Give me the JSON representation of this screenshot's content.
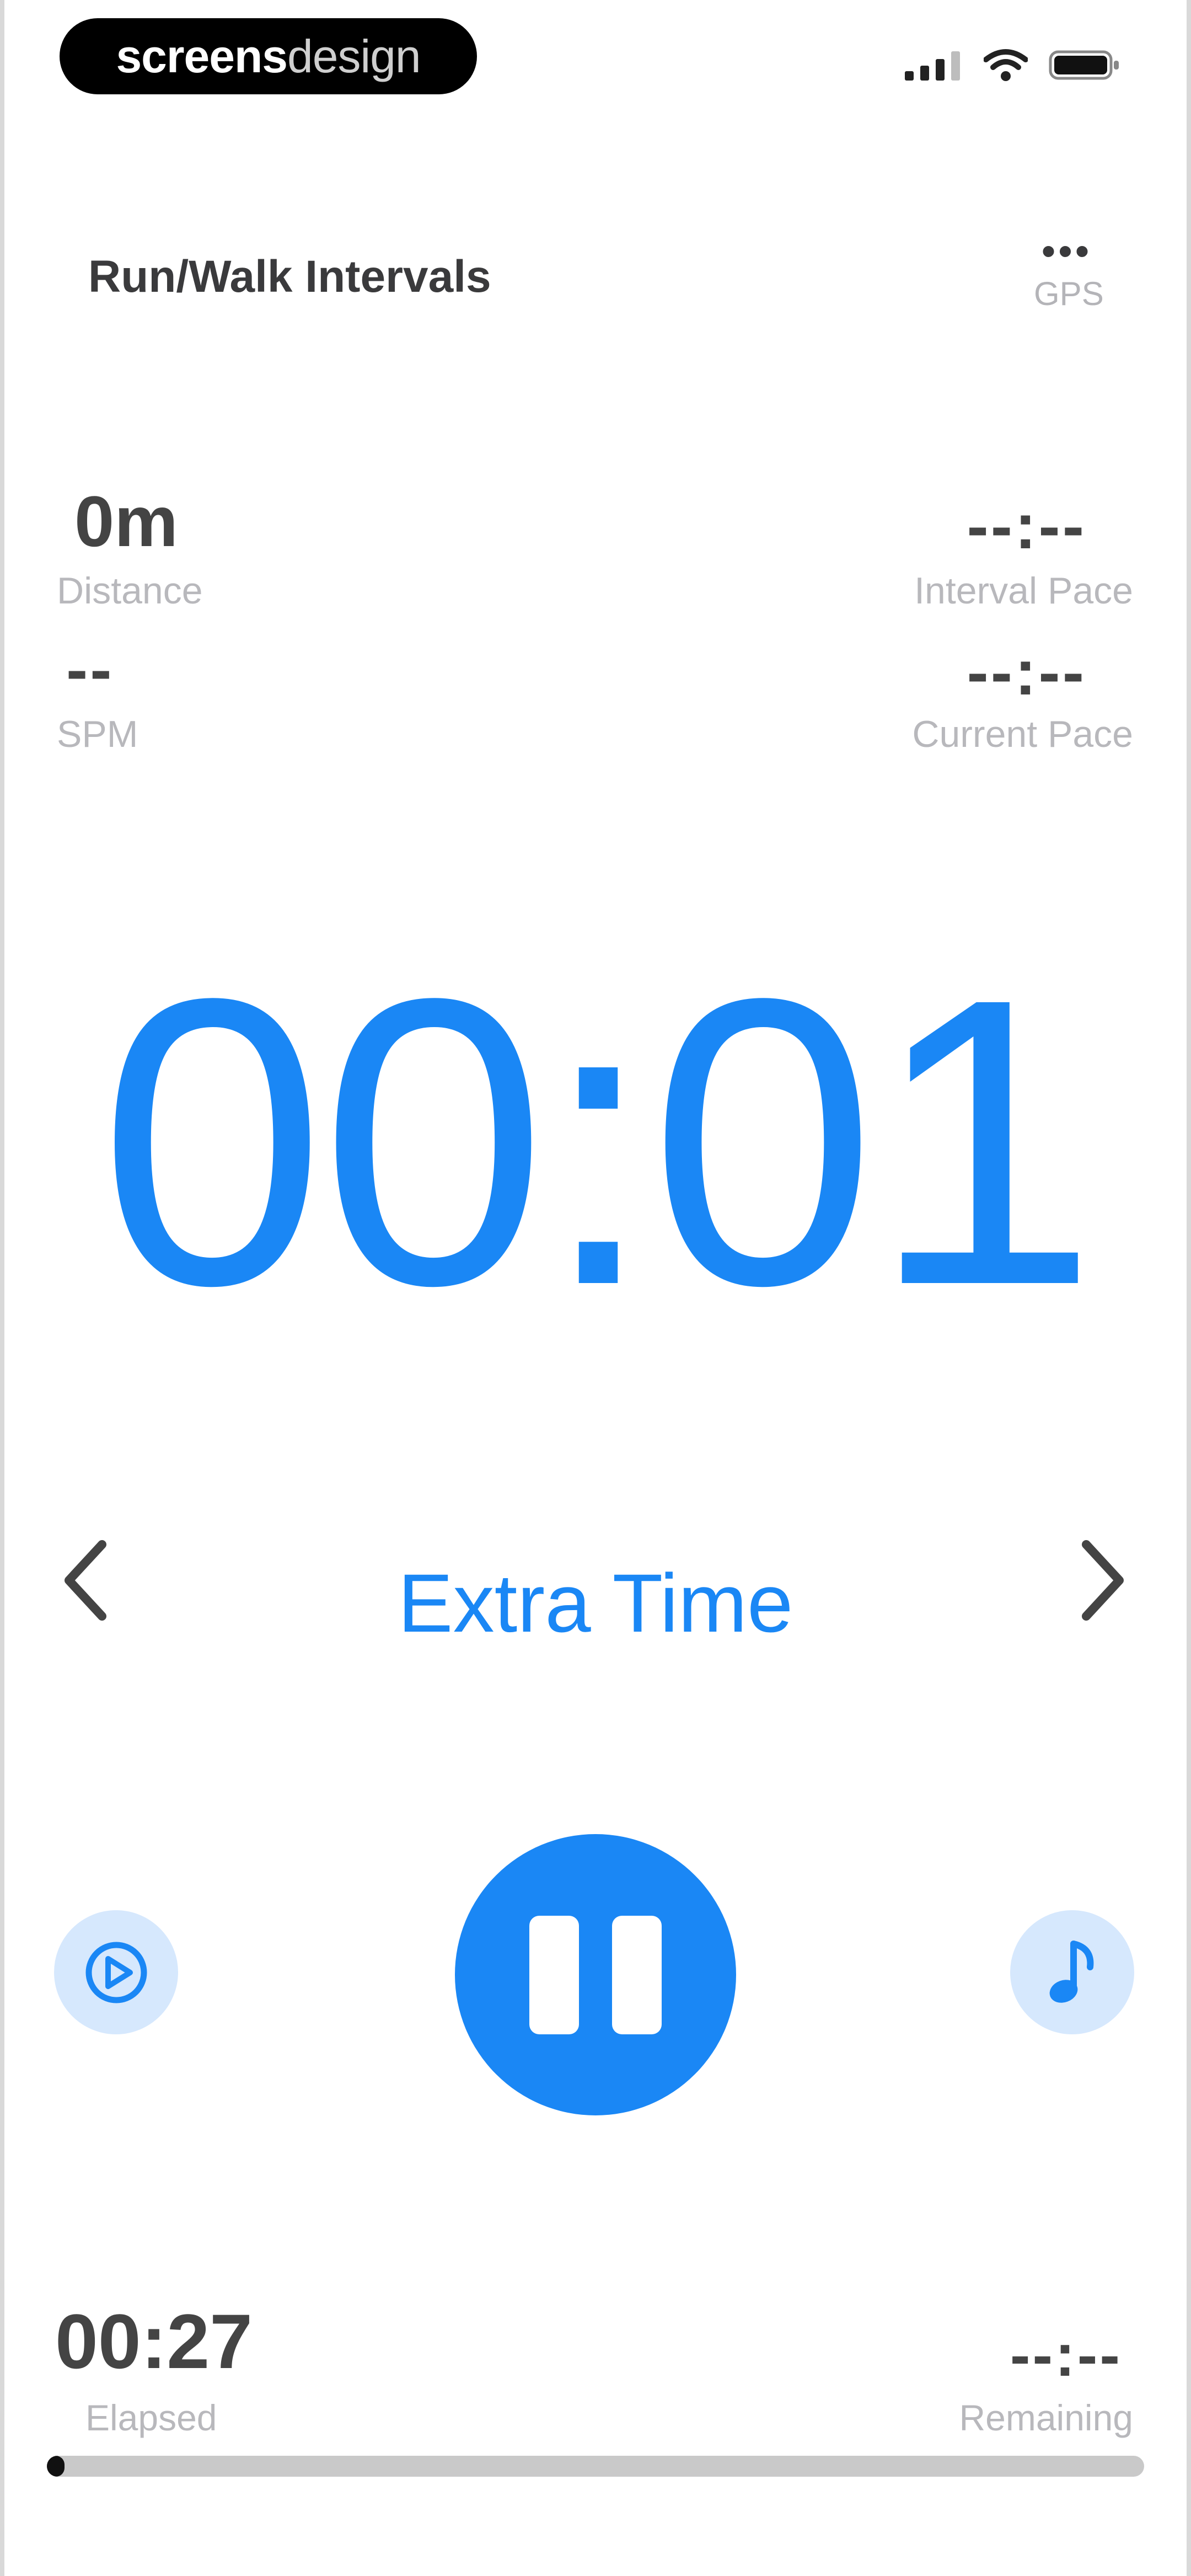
{
  "status_bar": {
    "brand_part1": "screens",
    "brand_part2": "design"
  },
  "header": {
    "title": "Run/Walk Intervals",
    "gps_dots": "•••",
    "gps_label": "GPS"
  },
  "stats": {
    "distance_value": "0m",
    "distance_label": "Distance",
    "interval_pace_value": "--:--",
    "interval_pace_label": "Interval Pace",
    "spm_value": "--",
    "spm_label": "SPM",
    "current_pace_value": "--:--",
    "current_pace_label": "Current Pace"
  },
  "timer": {
    "value": "00:01"
  },
  "phase": {
    "label": "Extra Time",
    "prev_icon": "chevron-left-icon",
    "next_icon": "chevron-right-icon"
  },
  "controls": {
    "left_icon": "play-circle-icon",
    "center_icon": "pause-icon",
    "right_icon": "music-note-icon"
  },
  "bottom": {
    "elapsed_value": "00:27",
    "elapsed_label": "Elapsed",
    "remaining_value": "--:--",
    "remaining_label": "Remaining",
    "progress_fraction": 0.005
  },
  "colors": {
    "accent": "#1a87f5",
    "accent_light": "#d6e8fd",
    "text_dark": "#3a3a3c",
    "text_muted": "#b8b8bc",
    "track": "#c9c9c9"
  }
}
